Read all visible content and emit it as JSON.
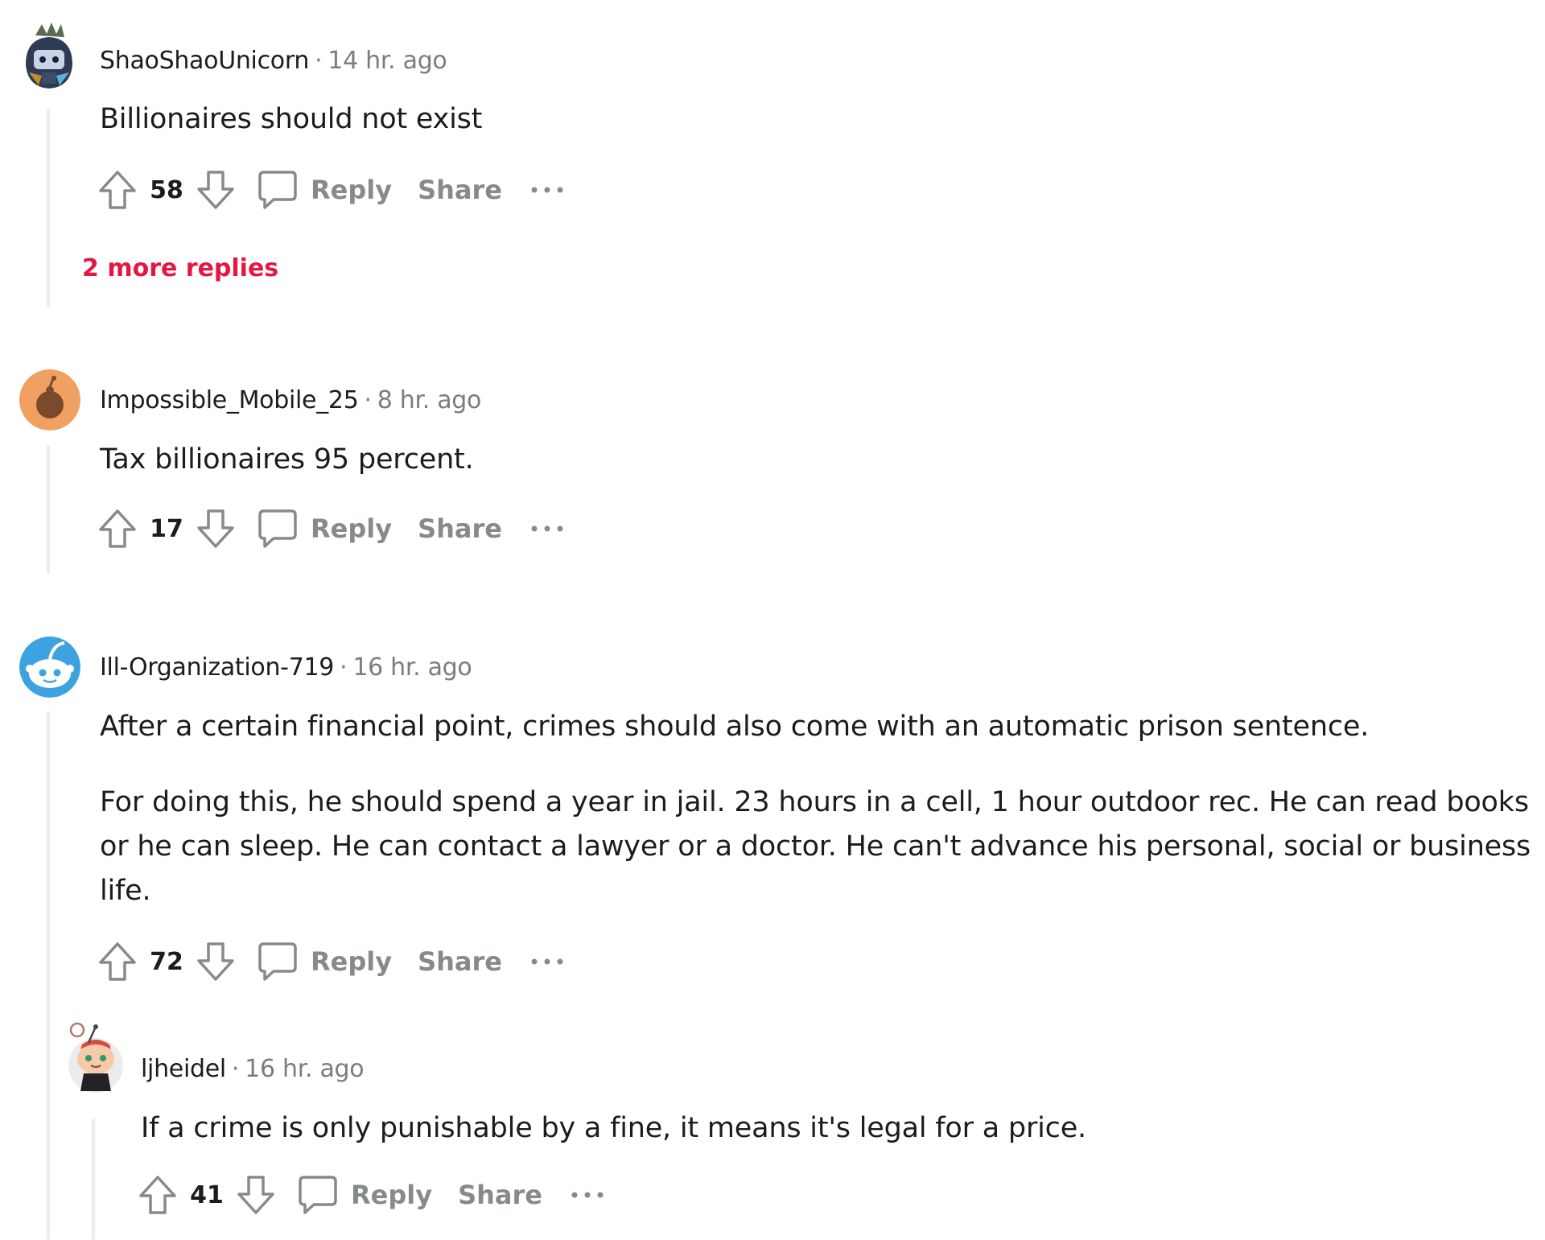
{
  "comments": [
    {
      "author": "ShaoShaoUnicorn",
      "separator": "·",
      "time": "14 hr. ago",
      "paragraphs": [
        "Billionaires should not exist"
      ],
      "score": "58",
      "reply_label": "Reply",
      "share_label": "Share",
      "more_replies": "2 more replies"
    },
    {
      "author": "Impossible_Mobile_25",
      "separator": "·",
      "time": "8 hr. ago",
      "paragraphs": [
        "Tax billionaires 95 percent."
      ],
      "score": "17",
      "reply_label": "Reply",
      "share_label": "Share"
    },
    {
      "author": "Ill-Organization-719",
      "separator": "·",
      "time": "16 hr. ago",
      "paragraphs": [
        "After a certain financial point, crimes should also come with an automatic prison sentence.",
        "For doing this, he should spend a year in jail. 23 hours in a cell, 1 hour outdoor rec. He can read books or he can sleep. He can contact a lawyer or a doctor. He can't advance his personal, social or business life."
      ],
      "score": "72",
      "reply_label": "Reply",
      "share_label": "Share"
    },
    {
      "author": "ljheidel",
      "separator": "·",
      "time": "16 hr. ago",
      "paragraphs": [
        "If a crime is only punishable by a fine, it means it's legal for a price."
      ],
      "score": "41",
      "reply_label": "Reply",
      "share_label": "Share"
    }
  ],
  "icons": {
    "upvote": "arrow-up-icon",
    "downvote": "arrow-down-icon",
    "reply": "speech-bubble-icon",
    "more": "ellipsis-icon"
  },
  "colors": {
    "more_replies": "#e5163f",
    "muted": "#878a8c",
    "thread_line": "#ededed"
  }
}
